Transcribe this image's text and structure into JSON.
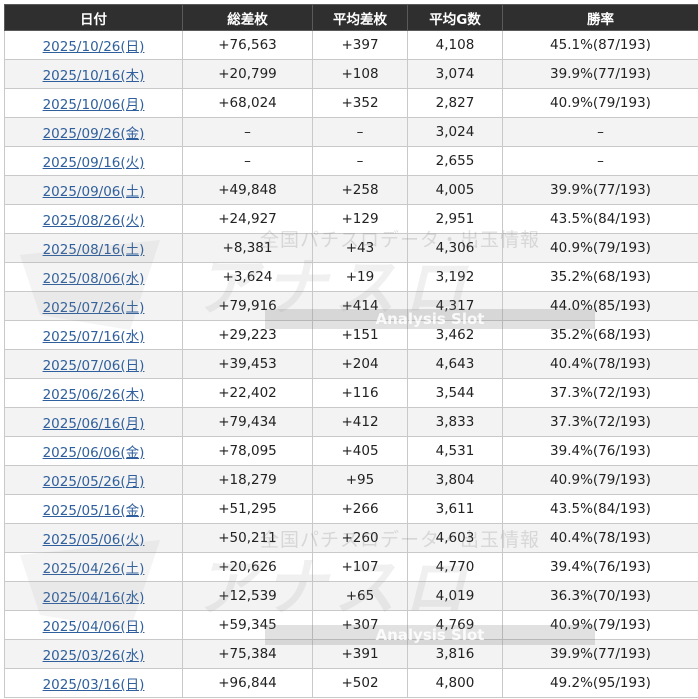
{
  "table": {
    "headers": [
      "日付",
      "総差枚",
      "平均差枚",
      "平均G数",
      "勝率"
    ],
    "rows": [
      [
        "2025/10/26(日)",
        "+76,563",
        "+397",
        "4,108",
        "45.1%(87/193)"
      ],
      [
        "2025/10/16(木)",
        "+20,799",
        "+108",
        "3,074",
        "39.9%(77/193)"
      ],
      [
        "2025/10/06(月)",
        "+68,024",
        "+352",
        "2,827",
        "40.9%(79/193)"
      ],
      [
        "2025/09/26(金)",
        "–",
        "–",
        "3,024",
        "–"
      ],
      [
        "2025/09/16(火)",
        "–",
        "–",
        "2,655",
        "–"
      ],
      [
        "2025/09/06(土)",
        "+49,848",
        "+258",
        "4,005",
        "39.9%(77/193)"
      ],
      [
        "2025/08/26(火)",
        "+24,927",
        "+129",
        "2,951",
        "43.5%(84/193)"
      ],
      [
        "2025/08/16(土)",
        "+8,381",
        "+43",
        "4,306",
        "40.9%(79/193)"
      ],
      [
        "2025/08/06(水)",
        "+3,624",
        "+19",
        "3,192",
        "35.2%(68/193)"
      ],
      [
        "2025/07/26(土)",
        "+79,916",
        "+414",
        "4,317",
        "44.0%(85/193)"
      ],
      [
        "2025/07/16(水)",
        "+29,223",
        "+151",
        "3,462",
        "35.2%(68/193)"
      ],
      [
        "2025/07/06(日)",
        "+39,453",
        "+204",
        "4,643",
        "40.4%(78/193)"
      ],
      [
        "2025/06/26(木)",
        "+22,402",
        "+116",
        "3,544",
        "37.3%(72/193)"
      ],
      [
        "2025/06/16(月)",
        "+79,434",
        "+412",
        "3,833",
        "37.3%(72/193)"
      ],
      [
        "2025/06/06(金)",
        "+78,095",
        "+405",
        "4,531",
        "39.4%(76/193)"
      ],
      [
        "2025/05/26(月)",
        "+18,279",
        "+95",
        "3,804",
        "40.9%(79/193)"
      ],
      [
        "2025/05/16(金)",
        "+51,295",
        "+266",
        "3,611",
        "43.5%(84/193)"
      ],
      [
        "2025/05/06(火)",
        "+50,211",
        "+260",
        "4,603",
        "40.4%(78/193)"
      ],
      [
        "2025/04/26(土)",
        "+20,626",
        "+107",
        "4,770",
        "39.4%(76/193)"
      ],
      [
        "2025/04/16(水)",
        "+12,539",
        "+65",
        "4,019",
        "36.3%(70/193)"
      ],
      [
        "2025/04/06(日)",
        "+59,345",
        "+307",
        "4,769",
        "40.9%(79/193)"
      ],
      [
        "2025/03/26(水)",
        "+75,384",
        "+391",
        "3,816",
        "39.9%(77/193)"
      ],
      [
        "2025/03/16(日)",
        "+96,844",
        "+502",
        "4,800",
        "49.2%(95/193)"
      ]
    ]
  },
  "watermark": {
    "caption": "全国パチスロデータ・出玉情報",
    "logo_text": "アナスロ",
    "bar_text": "Analysis Slot"
  },
  "colors": {
    "header_bg": "#2f2f2f",
    "link": "#2f5f9c",
    "alt_row": "#f3f3f3"
  }
}
